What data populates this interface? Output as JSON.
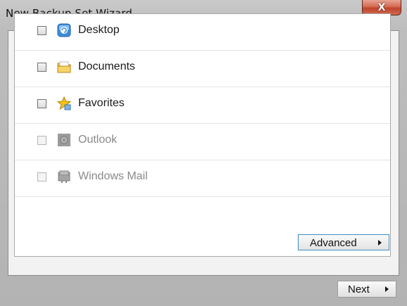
{
  "window": {
    "title": "New Backup Set Wizard",
    "close_label": "X"
  },
  "items": [
    {
      "label": "Desktop",
      "icon": "desktop-icon",
      "checked": false,
      "enabled": true
    },
    {
      "label": "Documents",
      "icon": "documents-folder-icon",
      "checked": false,
      "enabled": true
    },
    {
      "label": "Favorites",
      "icon": "favorites-star-icon",
      "checked": false,
      "enabled": true
    },
    {
      "label": "Outlook",
      "icon": "outlook-icon",
      "checked": false,
      "enabled": false
    },
    {
      "label": "Windows Mail",
      "icon": "windows-mail-icon",
      "checked": false,
      "enabled": false
    }
  ],
  "buttons": {
    "advanced": "Advanced",
    "next": "Next"
  },
  "colors": {
    "button_focus_border": "#3c8fc7",
    "close_button": "#c0432a",
    "disabled_text": "#8a8a8a"
  }
}
